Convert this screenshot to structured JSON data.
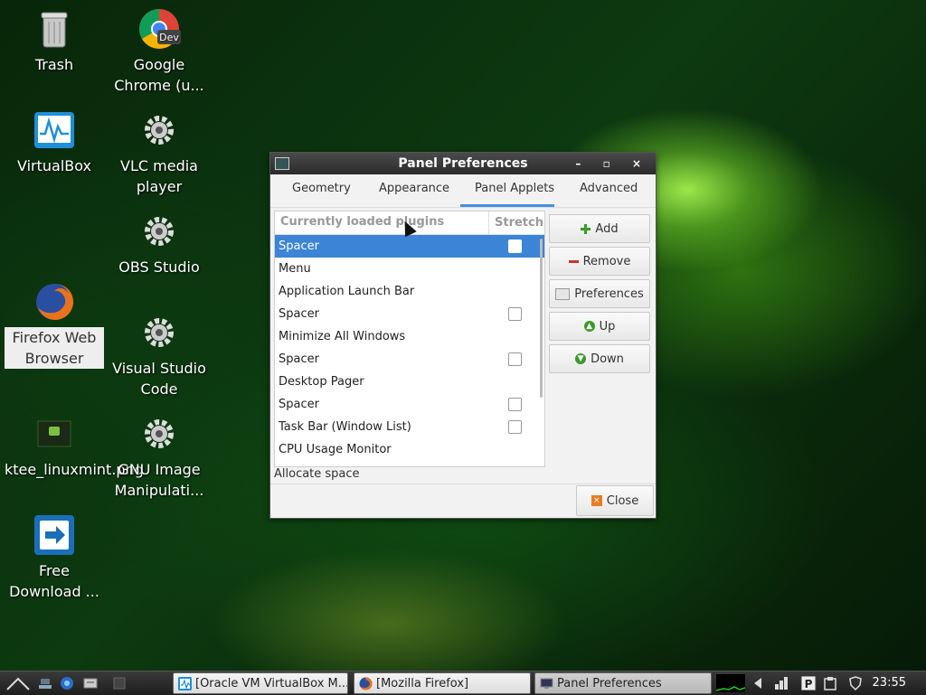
{
  "desktop": {
    "icons": [
      {
        "label": "Trash",
        "icon": "trash-icon"
      },
      {
        "label": "Google Chrome (u...",
        "icon": "chrome-dev-icon"
      },
      {
        "label": "VirtualBox",
        "icon": "virtualbox-icon"
      },
      {
        "label": "VLC media player",
        "icon": "gear-icon"
      },
      {
        "label": "OBS Studio",
        "icon": "gear-icon"
      },
      {
        "label": "Firefox Web Browser",
        "icon": "firefox-icon"
      },
      {
        "label": "Visual Studio Code",
        "icon": "gear-icon"
      },
      {
        "label": "ktee_linuxmint.png",
        "icon": "image-file-icon"
      },
      {
        "label": "GNU Image Manipulati...",
        "icon": "gear-icon"
      },
      {
        "label": "Free Download ...",
        "icon": "free-download-manager-icon"
      }
    ],
    "chrome_badge": "Dev"
  },
  "dialog": {
    "title": "Panel Preferences",
    "controls": [
      "–",
      "▫",
      "×"
    ],
    "tabs": [
      "Geometry",
      "Appearance",
      "Panel Applets",
      "Advanced"
    ],
    "active_tab": "Panel Applets",
    "columns": {
      "plugins": "Currently loaded plugins",
      "stretch": "Stretch"
    },
    "rows": [
      {
        "name": "Spacer",
        "stretch": false,
        "has_checkbox": true,
        "selected": true
      },
      {
        "name": "Menu",
        "has_checkbox": false
      },
      {
        "name": "Application Launch Bar",
        "has_checkbox": false
      },
      {
        "name": "Spacer",
        "stretch": false,
        "has_checkbox": true
      },
      {
        "name": "Minimize All Windows",
        "has_checkbox": false
      },
      {
        "name": "Spacer",
        "stretch": false,
        "has_checkbox": true
      },
      {
        "name": "Desktop Pager",
        "has_checkbox": false
      },
      {
        "name": "Spacer",
        "stretch": false,
        "has_checkbox": true
      },
      {
        "name": "Task Bar (Window List)",
        "stretch": false,
        "has_checkbox": true
      },
      {
        "name": "CPU Usage Monitor",
        "has_checkbox": false
      }
    ],
    "status_text": "Allocate space",
    "buttons": {
      "add": "Add",
      "remove": "Remove",
      "preferences": "Preferences",
      "up": "Up",
      "down": "Down",
      "close": "Close"
    }
  },
  "taskbar": {
    "tasks": [
      {
        "label": "[Oracle VM VirtualBox M...",
        "icon": "virtualbox-icon"
      },
      {
        "label": "[Mozilla Firefox]",
        "icon": "firefox-icon"
      },
      {
        "label": "Panel Preferences",
        "icon": "monitor-icon",
        "active": true
      }
    ],
    "clock": "23:55"
  }
}
